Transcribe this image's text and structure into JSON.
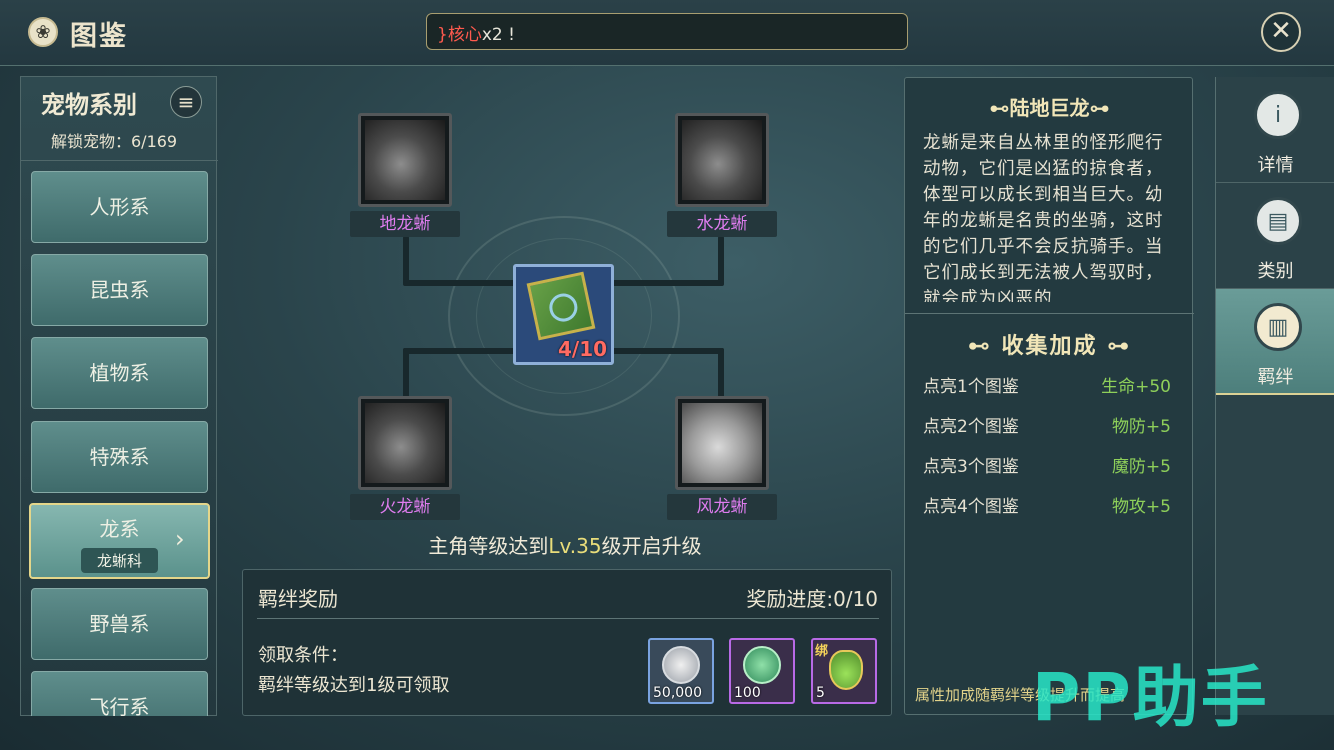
{
  "header": {
    "title": "图鉴",
    "ticker_prefix": "}核心",
    "ticker_rest": "x2 !"
  },
  "left": {
    "title": "宠物系别",
    "unlock": "解锁宠物：6/169",
    "categories": [
      "人形系",
      "昆虫系",
      "植物系",
      "特殊系",
      "龙系",
      "野兽系",
      "飞行系"
    ],
    "active_sub": "龙蜥科"
  },
  "tree": {
    "top_left": "地龙蜥",
    "top_right": "水龙蜥",
    "bottom_left": "火龙蜥",
    "bottom_right": "风龙蜥",
    "center_count": "4/10"
  },
  "unlock_msg": {
    "pre": "主角等级达到",
    "lv": "Lv.35",
    "post": "级开启升级"
  },
  "bond": {
    "title": "羁绊奖励",
    "progress": "奖励进度:0/10",
    "cond_label": "领取条件：",
    "cond": "羁绊等级达到1级可领取",
    "rewards": [
      {
        "amount": "50,000",
        "icon": "silver-coin-icon"
      },
      {
        "amount": "100",
        "icon": "green-paw-token-icon"
      },
      {
        "amount": "5",
        "icon": "potion-bottle-icon",
        "tag": "绑"
      }
    ]
  },
  "info": {
    "name": "⊷陆地巨龙⊶",
    "desc": "龙蜥是来自丛林里的怪形爬行动物，它们是凶猛的掠食者，体型可以成长到相当巨大。幼年的龙蜥是名贵的坐骑，这时的它们几乎不会反抗骑手。当它们成长到无法被人驾驭时，就会成为凶恶的",
    "collect_title": "⊷  收集加成  ⊶",
    "bonuses": [
      {
        "label": "点亮1个图鉴",
        "value": "生命+50"
      },
      {
        "label": "点亮2个图鉴",
        "value": "物防+5"
      },
      {
        "label": "点亮3个图鉴",
        "value": "魔防+5"
      },
      {
        "label": "点亮4个图鉴",
        "value": "物攻+5"
      }
    ],
    "footer": "属性加成随羁绊等级提升而提高"
  },
  "tabs": [
    {
      "label": "详情",
      "icon": "info-icon"
    },
    {
      "label": "类别",
      "icon": "category-card-icon"
    },
    {
      "label": "羁绊",
      "icon": "book-icon"
    }
  ],
  "watermark": "PP助手",
  "colors": {
    "accent_green": "#8ed05a",
    "accent_purple": "#e07df0",
    "accent_red": "#ff6b62",
    "gold": "#e4d68a"
  }
}
